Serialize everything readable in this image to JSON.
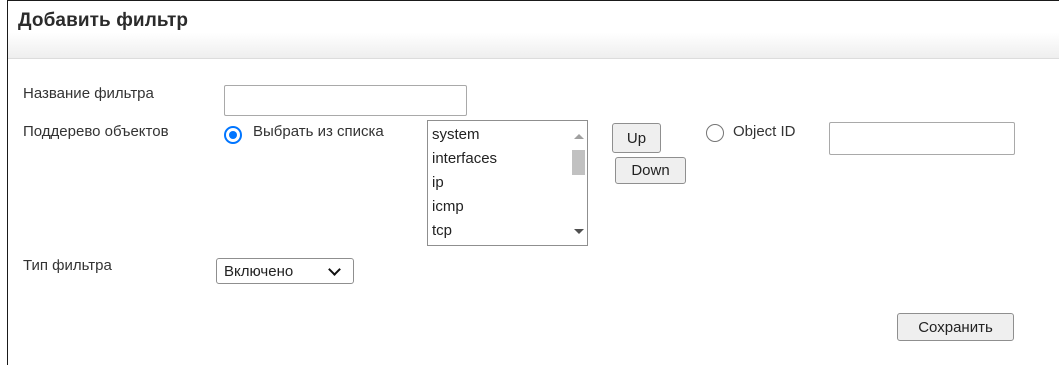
{
  "header": {
    "title": "Добавить фильтр"
  },
  "form": {
    "filter_name": {
      "label": "Название фильтра",
      "value": "",
      "placeholder": ""
    },
    "subtree": {
      "label": "Поддерево объектов",
      "select_from_list_label": "Выбрать из списка",
      "select_from_list_checked": true,
      "list_items": [
        "system",
        "interfaces",
        "ip",
        "icmp",
        "tcp"
      ],
      "up_label": "Up",
      "down_label": "Down",
      "object_id_label": "Object ID",
      "object_id_checked": false,
      "object_id_value": ""
    },
    "filter_type": {
      "label": "Тип фильтра",
      "selected": "Включено"
    },
    "save_label": "Сохранить"
  },
  "colors": {
    "radio_accent": "#0075ff",
    "header_gradient_end": "#eeeeee"
  },
  "icons": {
    "scroll_up": "scroll-up-arrow-icon",
    "scroll_down": "scroll-down-arrow-icon",
    "select_chevron": "chevron-down-icon"
  }
}
